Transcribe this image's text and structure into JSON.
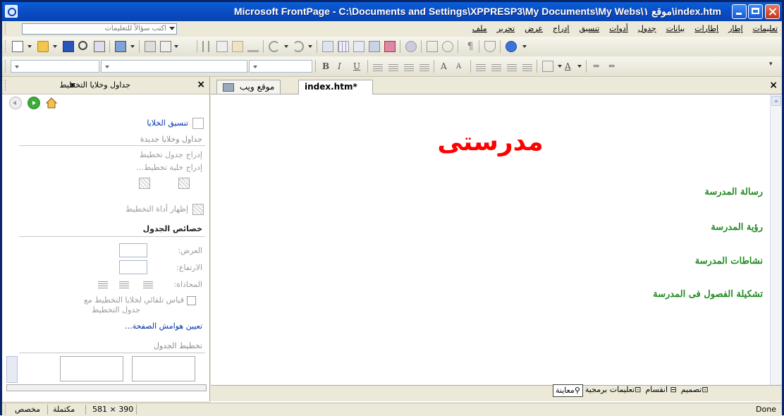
{
  "window": {
    "title": "Microsoft FrontPage - C:\\Documents and Settings\\XPPRESP3\\My Documents\\My Webs\\موقع ١\\index.htm"
  },
  "menu": {
    "items": [
      "ملف",
      "تحرير",
      "عرض",
      "إدراج",
      "تنسيق",
      "أدوات",
      "جدول",
      "بيانات",
      "إطارات",
      "إطار",
      "تعليمات"
    ],
    "ask_placeholder": "اكتب سؤالاً للتعليمات"
  },
  "task_pane": {
    "title": "جداول وخلايا التخطيط",
    "format_cells_link": "تنسيق الخلايا",
    "new_tables_heading": "جداول وخلايا جديدة",
    "insert_layout_table": "إدراج جدول تخطيط",
    "insert_layout_cell": "إدراج خلية تخطيط...",
    "show_layout_tool": "إظهار أداة التخطيط",
    "table_properties_heading": "خصائص الجدول",
    "width_label": "العرض:",
    "height_label": "الارتفاع:",
    "align_label": "المحاذاة:",
    "autoscale_label_line1": "قياس تلقائي لخلايا التخطيط مع",
    "autoscale_label_line2": "جدول التخطيط",
    "page_margins_link": "تعيين هوامش الصفحة...",
    "table_layout_heading": "تخطيط الجدول"
  },
  "doc_tabs": {
    "web_site_tab": "موقع ويب",
    "file_tab": "index.htm*"
  },
  "page": {
    "title": "مدرستى",
    "title_color": "#ff0000",
    "links_color": "#228b22",
    "links": [
      "رسالة المدرسة",
      "رؤية المدرسة",
      "نشاطات المدرسة",
      "تشكيلة الفصول فى المدرسة"
    ]
  },
  "views": {
    "design": "تصميم",
    "split": "انقسام",
    "code": "تعليمات برمجية",
    "preview": "معاينة"
  },
  "status": {
    "done": "Done",
    "size": "581 × 390",
    "complete": "مكتملة",
    "custom": "مخصص"
  },
  "colors": {
    "titlebar": "#0b4fc7",
    "chrome": "#ece9d8"
  }
}
